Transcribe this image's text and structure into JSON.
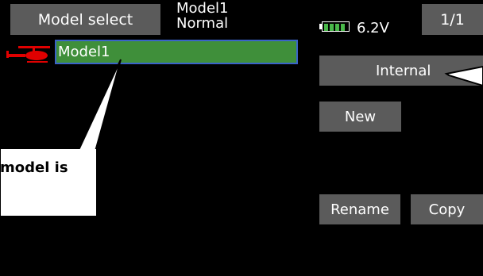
{
  "header": {
    "title": "Model select",
    "model_name": "Model1",
    "model_mode": "Normal",
    "voltage": "6.2V",
    "page_indicator": "1/1",
    "battery_level": 1.0,
    "battery_color": "#49b84a"
  },
  "model_list": {
    "items": [
      {
        "label": "Model1",
        "icon": "helicopter-icon",
        "selected": true
      }
    ],
    "highlight_color": "#3f8f3a",
    "selection_border_color": "#3a63c8"
  },
  "buttons": {
    "storage": "Internal",
    "new": "New",
    "rename": "Rename",
    "copy": "Copy"
  },
  "callouts": {
    "left": "model is"
  }
}
